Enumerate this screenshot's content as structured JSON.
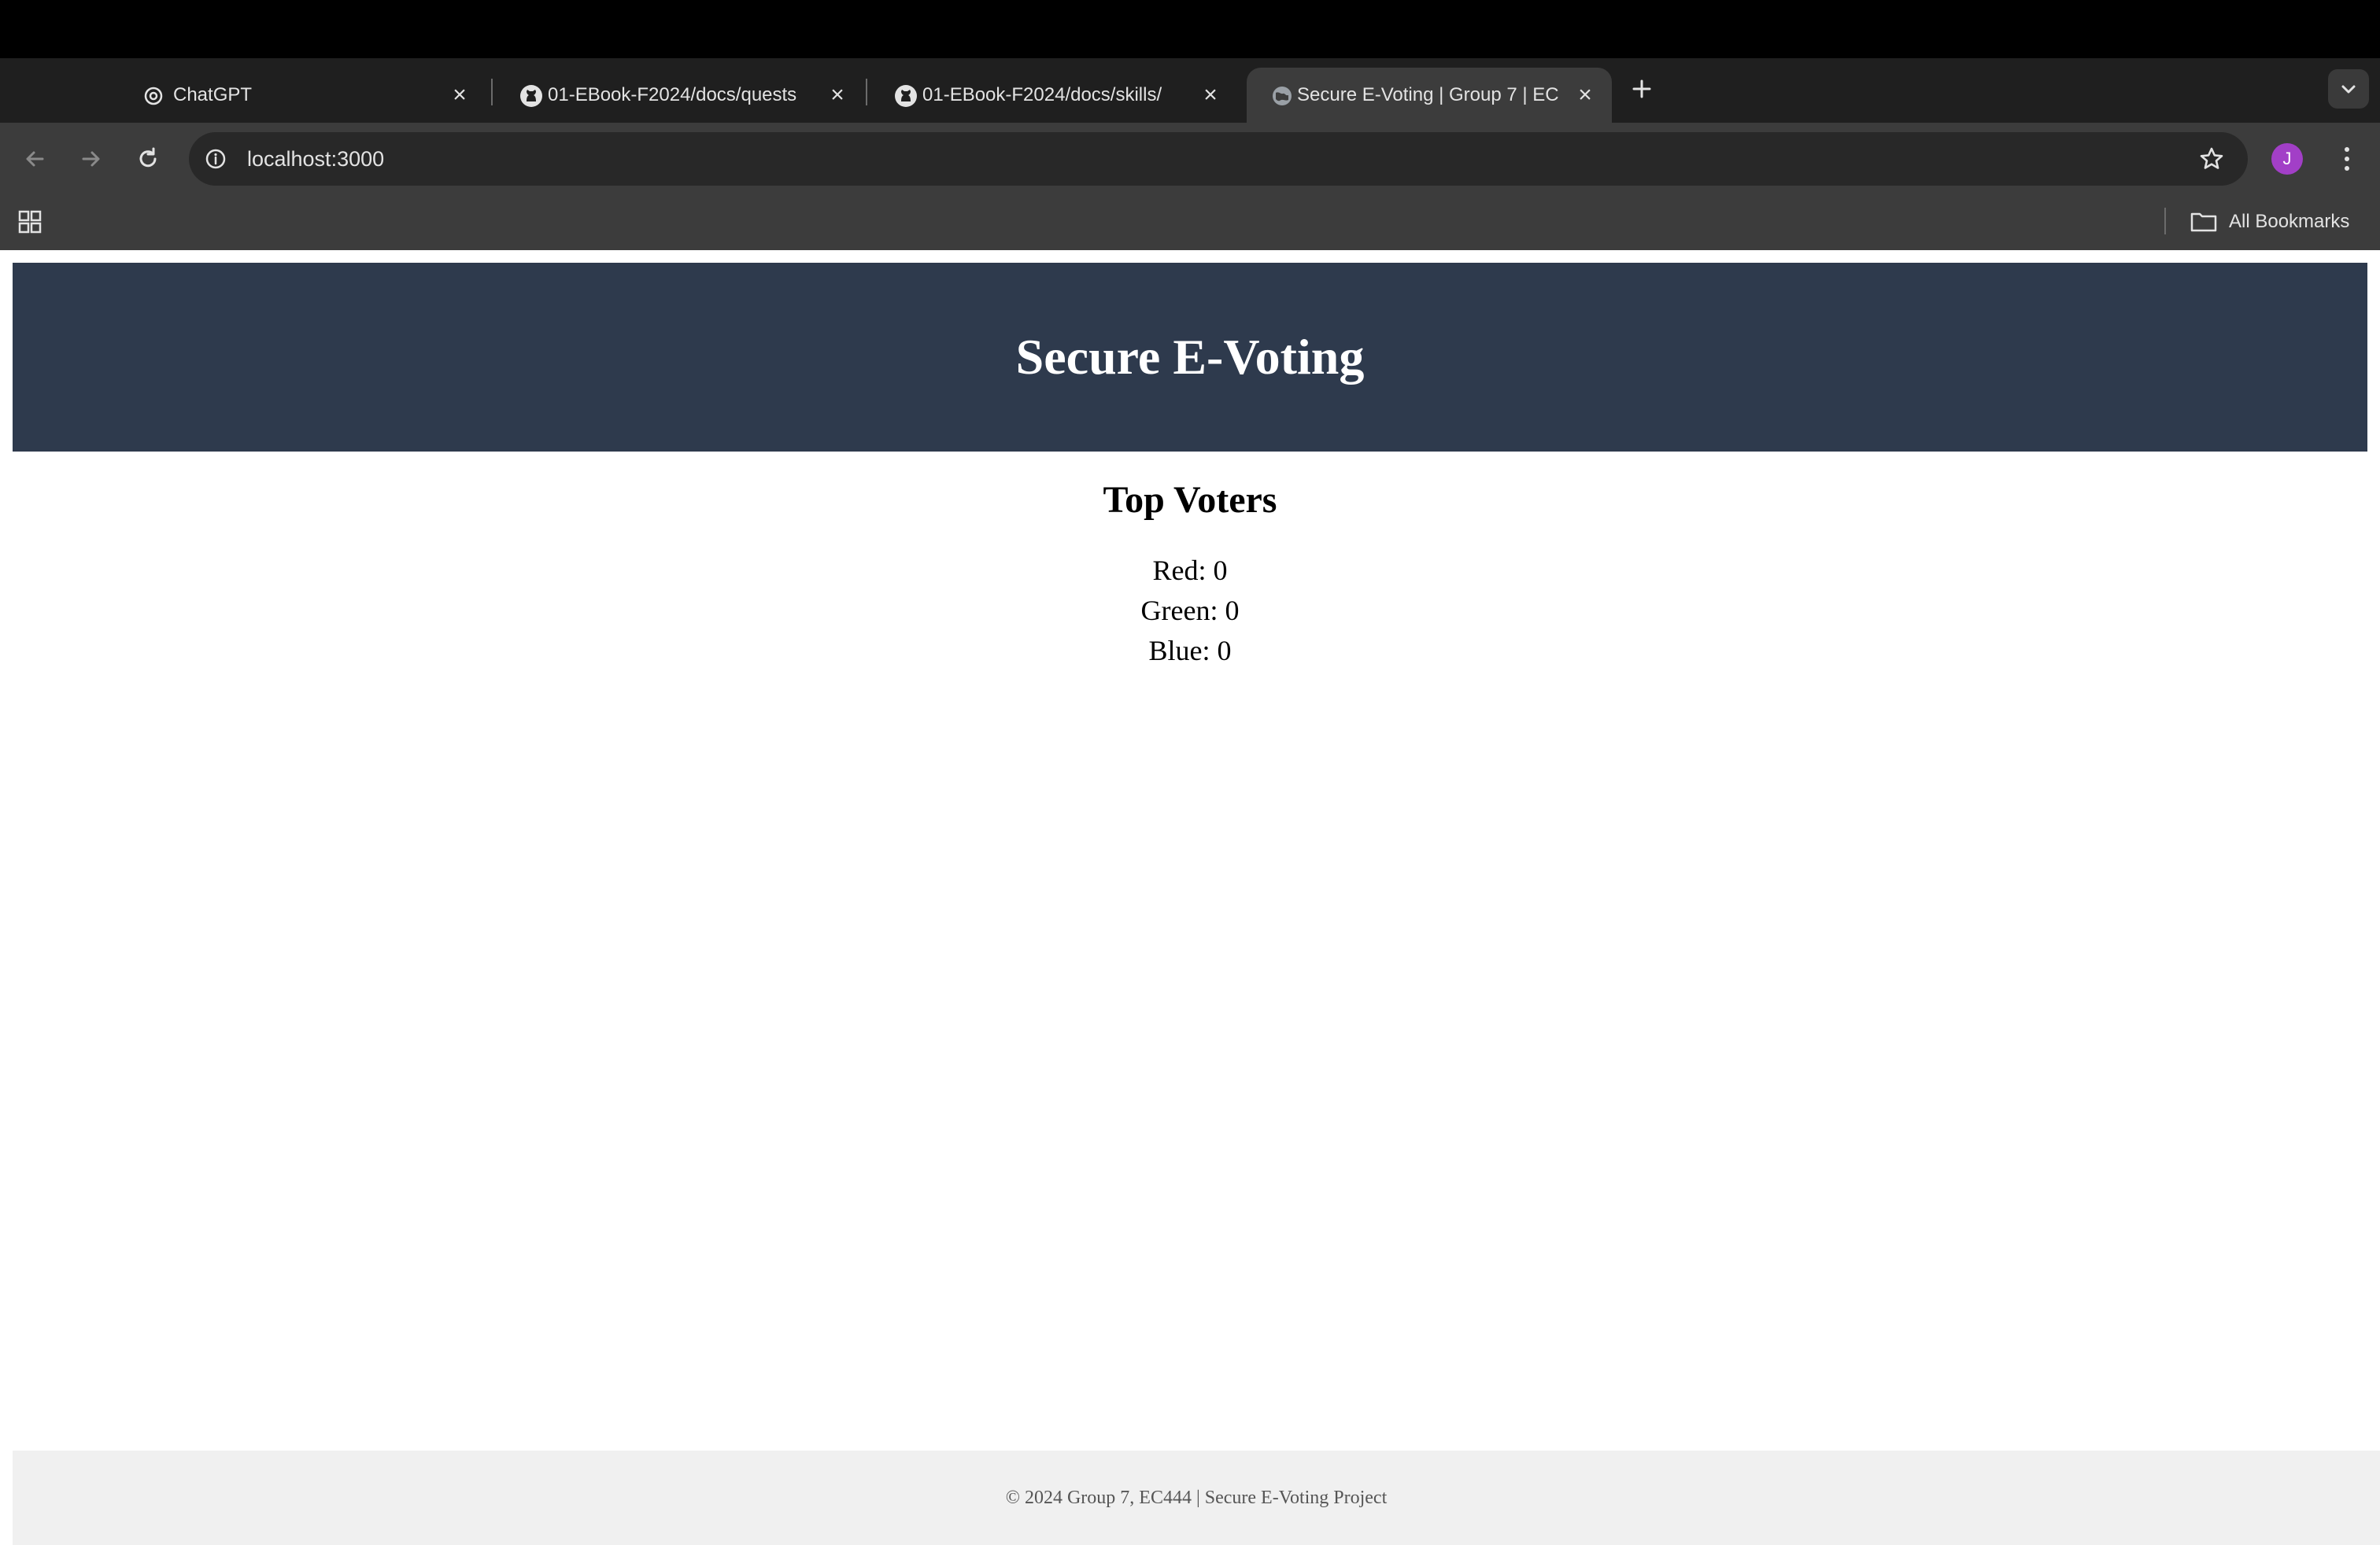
{
  "browser": {
    "tabs": [
      {
        "title": "ChatGPT",
        "icon": "chatgpt-icon",
        "active": false
      },
      {
        "title": "01-EBook-F2024/docs/quests",
        "icon": "github-icon",
        "active": false
      },
      {
        "title": "01-EBook-F2024/docs/skills/",
        "icon": "github-icon",
        "active": false
      },
      {
        "title": "Secure E-Voting | Group 7 | EC",
        "icon": "globe-icon",
        "active": true
      }
    ],
    "url": "localhost:3000",
    "profile_initial": "J",
    "profile_color": "#a23fc7",
    "bookmarks_label": "All Bookmarks"
  },
  "page": {
    "header_title": "Secure E-Voting",
    "header_color": "#2e3a4d",
    "section_title": "Top Voters",
    "tally": [
      {
        "label": "Red: 0"
      },
      {
        "label": "Green: 0"
      },
      {
        "label": "Blue: 0"
      }
    ],
    "footer_text": "© 2024 Group 7, EC444 | Secure E-Voting Project"
  }
}
